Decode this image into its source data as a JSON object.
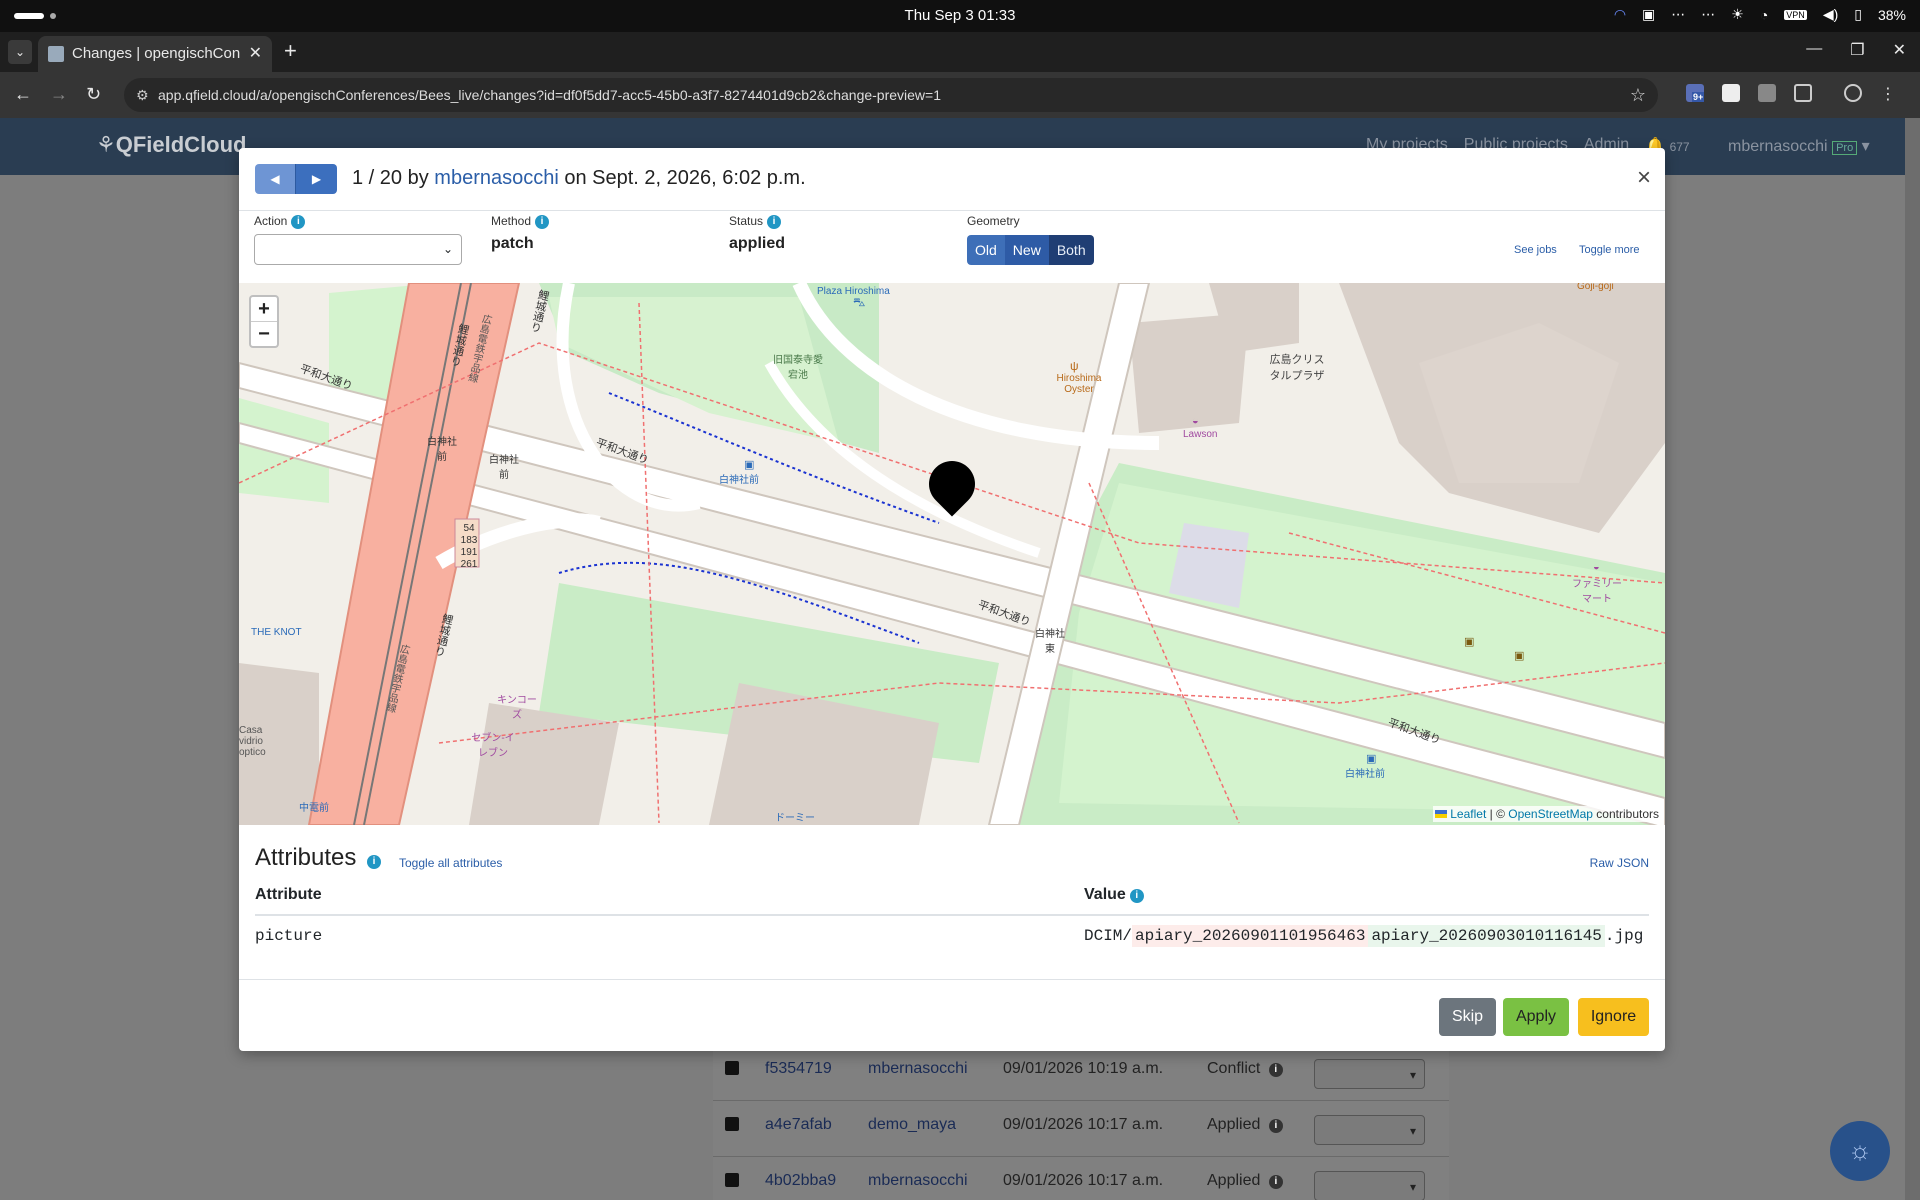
{
  "os": {
    "clock": "Thu Sep 3  01:33",
    "battery": "38%"
  },
  "browser": {
    "tab_title": "Changes | opengischCon",
    "url": "app.qfield.cloud/a/opengischConferences/Bees_live/changes?id=df0f5dd7-acc5-45b0-a3f7-8274401d9cb2&change-preview=1",
    "ext_badge": "9+"
  },
  "app": {
    "brand": "QFieldCloud",
    "nav_links": [
      "My projects",
      "Public projects",
      "Admin"
    ],
    "notifications": "677",
    "user": "mbernasocchi",
    "user_badge": "Pro"
  },
  "background_table": {
    "rows": [
      {
        "id": "f5354719",
        "user": "mbernasocchi",
        "date": "09/01/2026 10:19 a.m.",
        "status": "Conflict"
      },
      {
        "id": "a4e7afab",
        "user": "demo_maya",
        "date": "09/01/2026 10:17 a.m.",
        "status": "Applied"
      },
      {
        "id": "4b02bba9",
        "user": "mbernasocchi",
        "date": "09/01/2026 10:17 a.m.",
        "status": "Applied"
      }
    ]
  },
  "modal": {
    "counter": "1 / 20 by",
    "author": "mbernasocchi",
    "date_text": "on Sept. 2, 2026, 6:02 p.m.",
    "close": "×",
    "action_label": "Action",
    "method_label": "Method",
    "method_value": "patch",
    "status_label": "Status",
    "status_value": "applied",
    "geometry_label": "Geometry",
    "geometry_options": [
      "Old",
      "New",
      "Both"
    ],
    "see_jobs": "See jobs",
    "toggle_more": "Toggle more",
    "attributes_title": "Attributes",
    "toggle_all": "Toggle all attributes",
    "raw_json": "Raw JSON",
    "col_attribute": "Attribute",
    "col_value": "Value",
    "rows": [
      {
        "attribute": "picture",
        "prefix": "DCIM/",
        "old": "apiary_20260901101956463",
        "new": "apiary_20260903010116145",
        "suffix": ".jpg"
      }
    ],
    "buttons": {
      "skip": "Skip",
      "apply": "Apply",
      "ignore": "Ignore"
    }
  },
  "map": {
    "zoom_in": "+",
    "zoom_out": "−",
    "attribution_leaflet": "Leaflet",
    "attribution_sep": " | © ",
    "attribution_osm": "OpenStreetMap",
    "attribution_tail": " contributors",
    "labels": {
      "heiwa1": "平和大通り",
      "heiwa2": "平和大通り",
      "heiwa3": "平和大通り",
      "heiwa4": "平和大通り",
      "rijo1": "鯉城通り",
      "rijo2": "鯉城通り",
      "rijo3": "鯉城通り",
      "tram1": "広島電鉄宇品線",
      "tram2": "広島電鉄宇品線",
      "hakushin1": "白神社前",
      "hakushin2": "白神社前",
      "hakushin3": "白神社前",
      "hakushin_e": "白神社東",
      "hakushin4": "白神社前",
      "plaza": "Plaza Hiroshima",
      "aiko": "旧国泰寺愛宕池",
      "oyster": "Hiroshima Oyster",
      "crystal": "広島クリスタルプラザ",
      "lawson": "Lawson",
      "family": "ファミリーマート",
      "knot": "THE KNOT",
      "kinko": "キンコーズ",
      "seven": "セブン-イレブン",
      "casa": "Casa vidrio optico",
      "chudenmae": "中電前",
      "dormy": "ドーミー",
      "goji": "Goji-goji",
      "routes": [
        "54",
        "183",
        "191",
        "261"
      ]
    }
  }
}
